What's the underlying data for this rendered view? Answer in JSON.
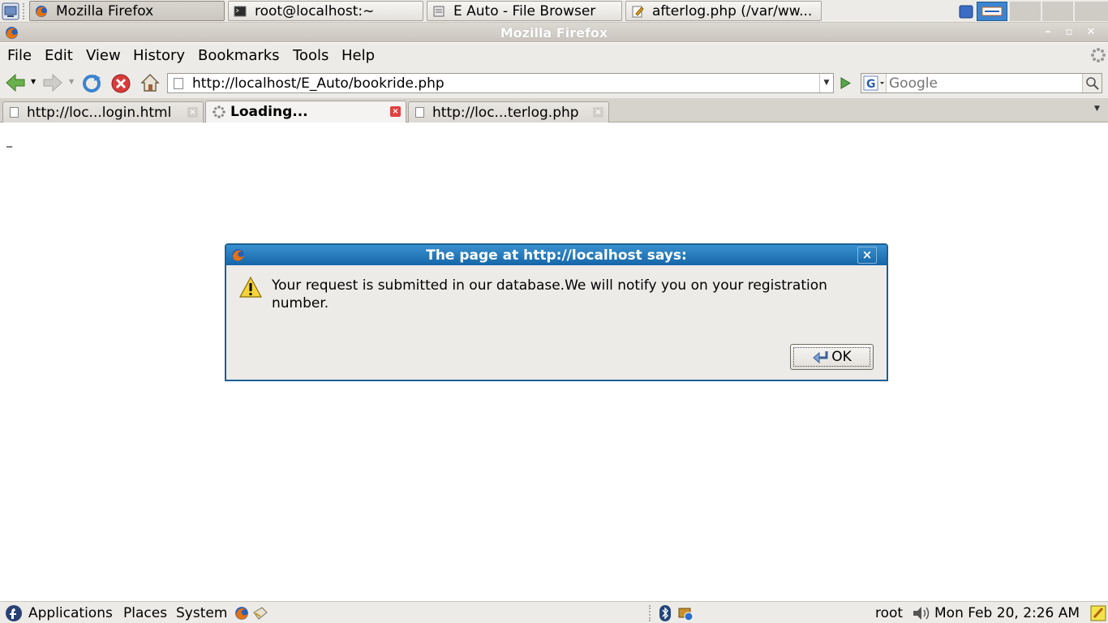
{
  "taskbar": {
    "tasks": [
      {
        "label": "Mozilla Firefox",
        "active": true
      },
      {
        "label": "root@localhost:~",
        "active": false
      },
      {
        "label": "E  Auto - File Browser",
        "active": false
      },
      {
        "label": "afterlog.php (/var/ww...",
        "active": false
      }
    ]
  },
  "window": {
    "title": "Mozilla Firefox"
  },
  "menubar": {
    "file": "File",
    "edit": "Edit",
    "view": "View",
    "history": "History",
    "bookmarks": "Bookmarks",
    "tools": "Tools",
    "help": "Help"
  },
  "navbar": {
    "url": "http://localhost/E_Auto/bookride.php",
    "search_placeholder": "Google"
  },
  "tabs": [
    {
      "label": "http://loc...login.html",
      "selected": false
    },
    {
      "label": "Loading...",
      "selected": true
    },
    {
      "label": "http://loc...terlog.php",
      "selected": false
    }
  ],
  "content": {
    "text": "_"
  },
  "dialog": {
    "title": "The page at http://localhost says:",
    "message": "Your request is submitted in our database.We will notify you on your registration number.",
    "ok_label": "OK",
    "close_glyph": "×"
  },
  "bottom_panel": {
    "applications": "Applications",
    "places": "Places",
    "system": "System",
    "user": "root",
    "clock": "Mon Feb 20,  2:26 AM"
  },
  "colors": {
    "dialog_title_bg": "#1566a8",
    "panel_bg": "#edebe7",
    "close_tab_red": "#e14040"
  }
}
